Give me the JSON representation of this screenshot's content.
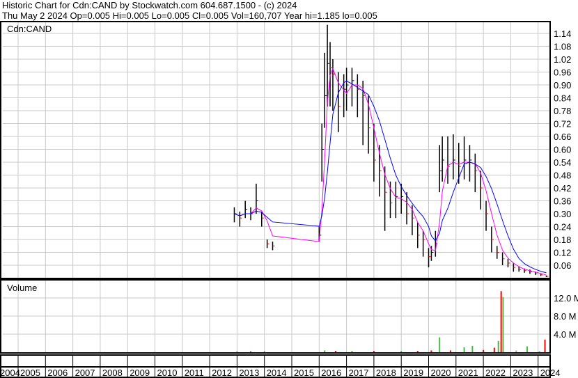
{
  "header": {
    "line1": "Historic Chart for Cdn:CAND by Stockwatch.com 604.687.1500 - (c) 2024",
    "line2": "Thu May  2 2024  Op=0.005  Hi=0.005  Lo=0.005  Cl=0.005  Vol=160,707  Year hi=1.185  lo=0.005"
  },
  "chart_data": [
    {
      "type": "line",
      "title": "Cdn:CAND",
      "ylim": [
        0,
        1.19
      ],
      "xlim": [
        2004,
        2024.4
      ],
      "yticks": [
        "0.06",
        "0.12",
        "0.18",
        "0.24",
        "0.30",
        "0.36",
        "0.42",
        "0.48",
        "0.54",
        "0.60",
        "0.66",
        "0.72",
        "0.78",
        "0.84",
        "0.90",
        "0.96",
        "1.02",
        "1.08",
        "1.14"
      ],
      "grid": true,
      "colors": {
        "price": "#000000",
        "down": "#ff0000",
        "ma_short": "#ff00ff",
        "ma_long": "#0000ff"
      },
      "x": [
        2012.9,
        2013.1,
        2013.3,
        2013.5,
        2013.7,
        2013.9,
        2014.1,
        2014.3,
        2016.0,
        2016.1,
        2016.2,
        2016.3,
        2016.4,
        2016.5,
        2016.7,
        2016.9,
        2017.0,
        2017.2,
        2017.4,
        2017.6,
        2017.8,
        2018.0,
        2018.2,
        2018.4,
        2018.6,
        2018.8,
        2019.0,
        2019.2,
        2019.4,
        2019.6,
        2019.8,
        2020.0,
        2020.1,
        2020.25,
        2020.4,
        2020.5,
        2020.7,
        2020.9,
        2021.1,
        2021.3,
        2021.5,
        2021.7,
        2021.9,
        2022.1,
        2022.3,
        2022.5,
        2022.7,
        2022.9,
        2023.1,
        2023.3,
        2023.5,
        2023.7,
        2023.9,
        2024.1,
        2024.3
      ],
      "close": [
        0.3,
        0.28,
        0.32,
        0.3,
        0.36,
        0.28,
        0.16,
        0.15,
        0.2,
        0.6,
        0.85,
        1.0,
        0.98,
        0.95,
        0.8,
        0.88,
        0.9,
        0.92,
        0.88,
        0.85,
        0.7,
        0.55,
        0.5,
        0.4,
        0.35,
        0.38,
        0.38,
        0.3,
        0.28,
        0.2,
        0.18,
        0.1,
        0.12,
        0.16,
        0.5,
        0.55,
        0.52,
        0.55,
        0.52,
        0.55,
        0.55,
        0.5,
        0.42,
        0.3,
        0.18,
        0.12,
        0.09,
        0.07,
        0.05,
        0.04,
        0.035,
        0.03,
        0.02,
        0.015,
        0.008
      ],
      "high": [
        0.33,
        0.31,
        0.36,
        0.33,
        0.44,
        0.31,
        0.18,
        0.17,
        0.24,
        0.72,
        1.05,
        1.18,
        1.1,
        1.02,
        0.96,
        0.95,
        0.98,
        0.98,
        0.95,
        0.92,
        0.85,
        0.72,
        0.62,
        0.52,
        0.45,
        0.45,
        0.44,
        0.4,
        0.34,
        0.26,
        0.22,
        0.14,
        0.15,
        0.22,
        0.62,
        0.66,
        0.66,
        0.67,
        0.63,
        0.66,
        0.62,
        0.58,
        0.5,
        0.36,
        0.24,
        0.15,
        0.12,
        0.09,
        0.07,
        0.055,
        0.045,
        0.04,
        0.03,
        0.02,
        0.012
      ],
      "low": [
        0.26,
        0.24,
        0.28,
        0.27,
        0.3,
        0.24,
        0.14,
        0.13,
        0.17,
        0.45,
        0.7,
        0.8,
        0.8,
        0.78,
        0.68,
        0.75,
        0.78,
        0.8,
        0.75,
        0.62,
        0.58,
        0.45,
        0.38,
        0.22,
        0.28,
        0.28,
        0.3,
        0.25,
        0.2,
        0.14,
        0.1,
        0.05,
        0.08,
        0.1,
        0.4,
        0.45,
        0.44,
        0.46,
        0.44,
        0.46,
        0.45,
        0.4,
        0.32,
        0.22,
        0.12,
        0.09,
        0.06,
        0.05,
        0.03,
        0.03,
        0.025,
        0.02,
        0.015,
        0.01,
        0.005
      ]
    },
    {
      "type": "bar",
      "title": "Volume",
      "ylim": [
        0,
        14
      ],
      "yticks": [
        "4.0 M",
        "8.0 M",
        "12.0 M"
      ],
      "x": [
        2013.0,
        2013.5,
        2014.0,
        2016.2,
        2016.6,
        2017.2,
        2018.0,
        2019.0,
        2019.6,
        2020.1,
        2020.4,
        2020.8,
        2021.3,
        2021.6,
        2022.0,
        2022.4,
        2022.55,
        2022.65,
        2022.72,
        2023.2,
        2023.6,
        2024.05,
        2024.25
      ],
      "values": [
        0.2,
        0.2,
        0.15,
        0.4,
        0.3,
        0.3,
        0.3,
        0.3,
        0.3,
        0.4,
        3.3,
        0.4,
        1.1,
        1.4,
        0.5,
        1.0,
        2.5,
        13.5,
        12.2,
        0.4,
        1.3,
        0.3,
        2.8
      ],
      "colors": [
        "#4cb848",
        "#ff0000",
        "#ff0000",
        "#4cb848",
        "#ff0000",
        "#4cb848",
        "#ff0000",
        "#4cb848",
        "#ff0000",
        "#ff0000",
        "#4cb848",
        "#ff0000",
        "#4cb848",
        "#4cb848",
        "#ff0000",
        "#ff0000",
        "#4cb848",
        "#ff0000",
        "#4cb848",
        "#aaaaaa",
        "#4cb848",
        "#aaaaaa",
        "#ff0000"
      ]
    }
  ],
  "xaxis": {
    "years": [
      "2004",
      "2005",
      "2006",
      "2007",
      "2008",
      "2009",
      "2010",
      "2011",
      "2012",
      "2013",
      "2014",
      "2015",
      "2016",
      "2017",
      "2018",
      "2019",
      "2020",
      "2021",
      "2022",
      "2023",
      "2024"
    ]
  }
}
